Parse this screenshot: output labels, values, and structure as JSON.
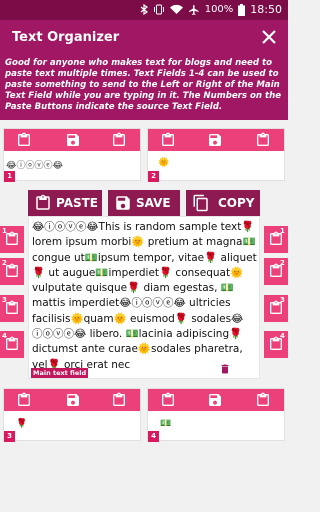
{
  "status": {
    "battery": "100%",
    "time": "18:50"
  },
  "app": {
    "title": "Text Organizer",
    "description": "Good for anyone who makes text for blogs and need to paste text multiple times. Text Fields 1-4 can be used to paste something to send to the Left or Right of the Main Text Field while you are typing in it. The Numbers on the Paste Buttons indicate the source Text Field."
  },
  "fields": [
    {
      "num": "1",
      "content": "😂ⓘⓞⓥⓔ😂"
    },
    {
      "num": "2",
      "content": "🌞"
    },
    {
      "num": "3",
      "content": "🌹"
    },
    {
      "num": "4",
      "content": "💵"
    }
  ],
  "side_left": [
    "1",
    "2",
    "3",
    "4"
  ],
  "side_right": [
    "1",
    "2",
    "3",
    "4"
  ],
  "actions": {
    "paste": "PASTE",
    "save": "SAVE",
    "copy": "COPY"
  },
  "main": {
    "text": "😂ⓘⓞⓥⓔ😂This is random sample text🌹 lorem ipsum morbi🌞 pretium at magna💵 congue ut💵ipsum tempor, vitae🌹 aliquet🌹 ut augue💵imperdiet🌹 consequat🌞 vulputate quisque🌹 diam egestas, 💵mattis imperdiet😂ⓘⓞⓥⓔ😂 ultricies facilisis🌞quam🌞 euismod🌹 sodales😂ⓘⓞⓥⓔ😂 libero. 💵lacinia adipiscing🌹 dictumst ante curae🌞sodales pharetra, vel🌹 orci erat nec",
    "label": "Main text field"
  },
  "colors": {
    "primary": "#a01863",
    "statusbar": "#7c0c47",
    "accent": "#ec407a",
    "button": "#8e1a52"
  }
}
